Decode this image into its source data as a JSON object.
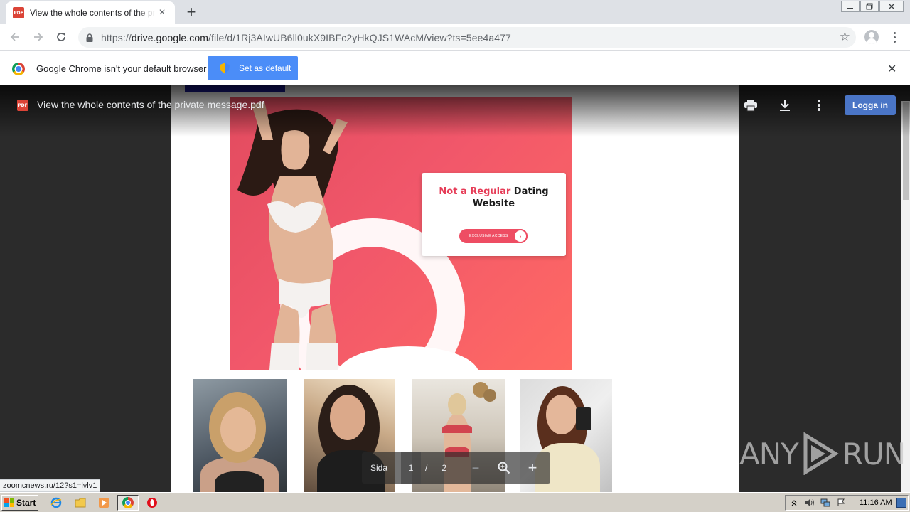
{
  "browser": {
    "tab": {
      "title": "View the whole contents of the private message.pdf",
      "favicon": "PDF"
    },
    "new_tab_symbol": "+",
    "window_controls": [
      "minimize-icon",
      "restore-icon",
      "close-icon"
    ],
    "address": {
      "scheme": "https://",
      "host": "drive.google.com",
      "path": "/file/d/1Rj3AIwUB6ll0ukX9IBFc2yHkQJS1WAcM/view?ts=5ee4a477"
    },
    "icons": [
      "back-arrow-icon",
      "forward-arrow-icon",
      "reload-icon",
      "lock-icon",
      "star-icon",
      "profile-icon",
      "menu-icon"
    ]
  },
  "infobar": {
    "message": "Google Chrome isn't your default browser",
    "button": "Set as default",
    "close": "✕"
  },
  "viewer": {
    "file_icon": "PDF",
    "title": "View the whole contents of the private message.pdf",
    "login_button": "Logga in",
    "actions": [
      "print-icon",
      "download-icon",
      "more-options-icon"
    ],
    "page_content": {
      "ad_headline_accent": "Not a Regular",
      "ad_headline_rest": " Dating",
      "ad_headline_line2": "Website",
      "ad_button": "EXCLUSIVE ACCESS",
      "ad_button_arrow": "›"
    },
    "pager": {
      "label": "Sida",
      "current": "1",
      "separator": "/",
      "total": "2",
      "zoom_out": "−",
      "zoom_in": "+"
    },
    "watermark": {
      "left": "ANY",
      "right": "RUN"
    }
  },
  "status_url": "zoomcnews.ru/12?s1=lvlv1",
  "taskbar": {
    "start_label": "Start",
    "quick_launch": [
      "ie-icon",
      "folder-icon",
      "media-player-icon",
      "chrome-icon",
      "opera-icon"
    ],
    "clock": "11:16 AM"
  },
  "colors": {
    "accent_blue": "#4b8df8",
    "login_blue": "#4a75c6",
    "ad_pink": "#ee4d63"
  }
}
